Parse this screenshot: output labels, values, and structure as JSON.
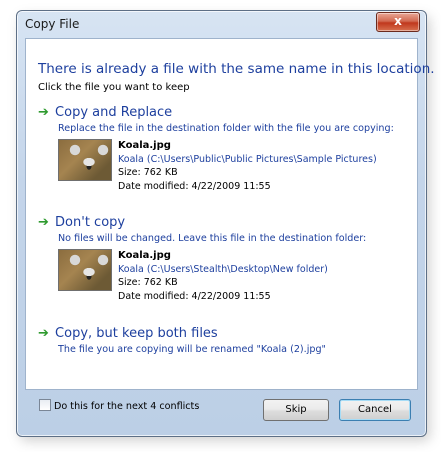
{
  "window": {
    "title": "Copy File",
    "close_icon": "close-icon",
    "close_glyph": "x"
  },
  "header": {
    "heading": "There is already a file with the same name in this location.",
    "subheading": "Click the file you want to keep"
  },
  "options": [
    {
      "title": "Copy and Replace",
      "description": "Replace the file in the destination folder with the file you are copying:",
      "file": {
        "name": "Koala.jpg",
        "path": "Koala (C:\\Users\\Public\\Public Pictures\\Sample Pictures)",
        "size": "Size: 762 KB",
        "modified": "Date modified: 4/22/2009 11:55"
      }
    },
    {
      "title": "Don't copy",
      "description": "No files will be changed. Leave this file in the destination folder:",
      "file": {
        "name": "Koala.jpg",
        "path": "Koala (C:\\Users\\Stealth\\Desktop\\New folder)",
        "size": "Size: 762 KB",
        "modified": "Date modified: 4/22/2009 11:55"
      }
    },
    {
      "title": "Copy, but keep both files",
      "description": "The file you are copying will be renamed \"Koala (2).jpg\""
    }
  ],
  "footer": {
    "checkbox_label": "Do this for the next 4 conflicts",
    "checkbox_checked": false,
    "skip_label": "Skip",
    "cancel_label": "Cancel"
  },
  "icons": {
    "arrow": "green-arrow-icon",
    "arrow_color": "#2e9a2e"
  },
  "colors": {
    "link_blue": "#1d3f9e",
    "close_red": "#c0381d"
  }
}
